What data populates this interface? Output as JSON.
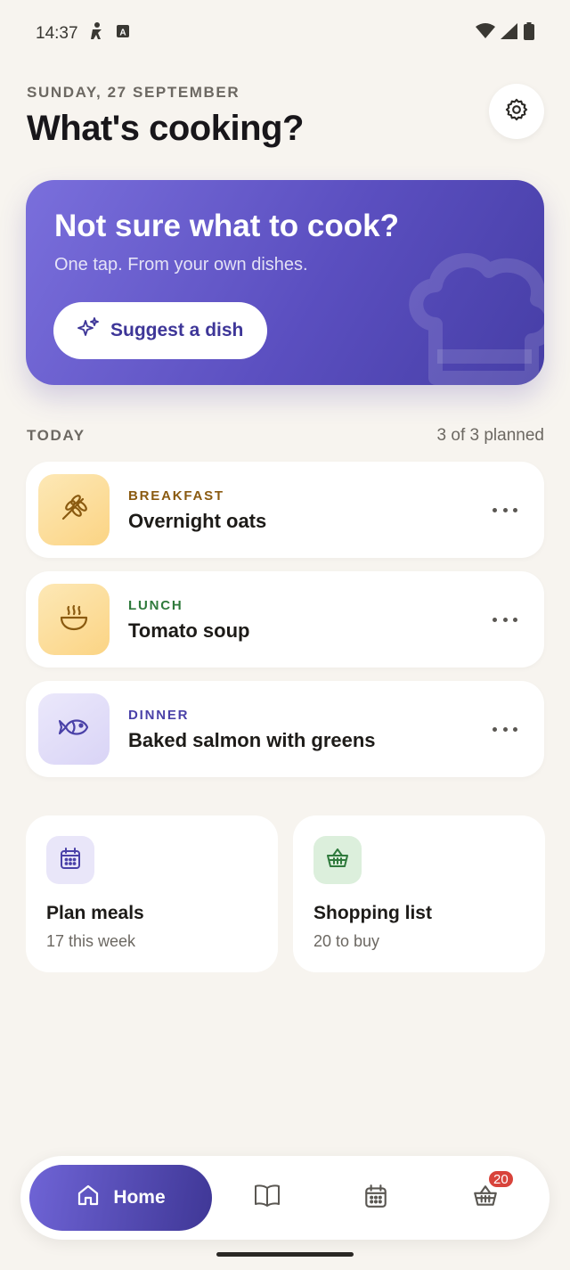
{
  "status_bar": {
    "time": "14:37",
    "icons": [
      "accessibility-icon",
      "keyboard-a-icon",
      "wifi-icon",
      "signal-icon",
      "battery-icon"
    ]
  },
  "header": {
    "date": "SUNDAY, 27 SEPTEMBER",
    "title": "What's cooking?",
    "settings_icon": "gear-icon"
  },
  "hero": {
    "title": "Not sure what to cook?",
    "subtitle": "One tap. From your own dishes.",
    "button_label": "Suggest a dish",
    "button_icon": "sparkle-icon",
    "decoration_icon": "chef-hat-icon"
  },
  "today": {
    "label": "TODAY",
    "count": "3 of 3 planned",
    "meals": [
      {
        "type": "BREAKFAST",
        "name": "Overnight oats",
        "icon": "wheat-icon",
        "type_color": "#8a5a10"
      },
      {
        "type": "LUNCH",
        "name": "Tomato soup",
        "icon": "soup-bowl-icon",
        "type_color": "#2f7a3c"
      },
      {
        "type": "DINNER",
        "name": "Baked salmon with greens",
        "icon": "fish-icon",
        "type_color": "#4a41a8"
      }
    ]
  },
  "quick_actions": [
    {
      "title": "Plan meals",
      "subtitle": "17 this week",
      "icon": "calendar-icon"
    },
    {
      "title": "Shopping list",
      "subtitle": "20 to buy",
      "icon": "basket-icon"
    }
  ],
  "bottom_nav": {
    "home_label": "Home",
    "items": [
      "home-icon",
      "book-icon",
      "calendar-icon",
      "basket-icon"
    ],
    "basket_badge": "20"
  },
  "colors": {
    "accent": "#5b4fc0",
    "background": "#f7f4ef",
    "badge": "#d8433b"
  }
}
